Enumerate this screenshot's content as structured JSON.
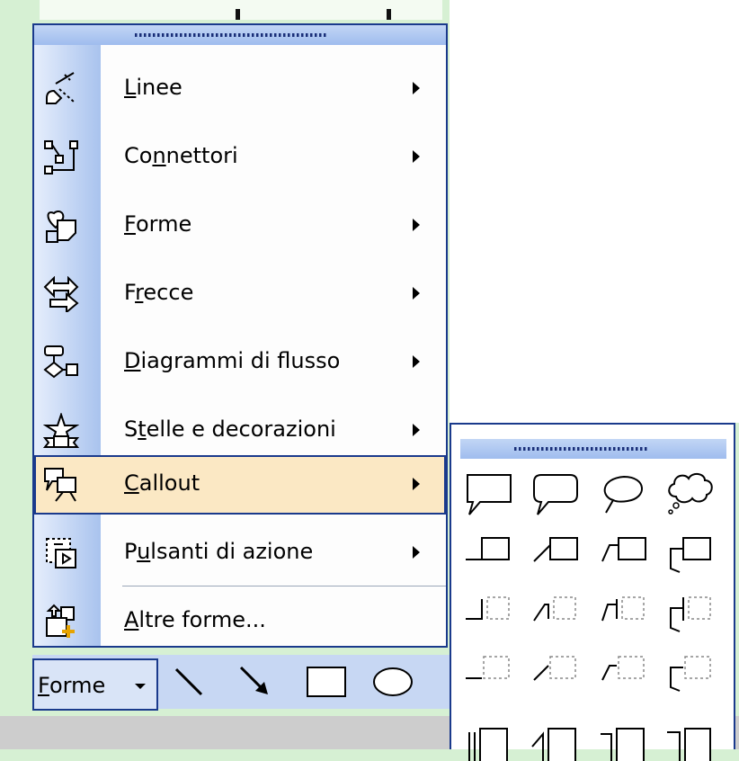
{
  "menu": {
    "items": [
      {
        "label_pre": "",
        "label_key": "L",
        "label_post": "inee",
        "icon": "lines-icon"
      },
      {
        "label_pre": "Co",
        "label_key": "n",
        "label_post": "nettori",
        "icon": "connectors-icon"
      },
      {
        "label_pre": "",
        "label_key": "F",
        "label_post": "orme",
        "icon": "basic-shapes-icon"
      },
      {
        "label_pre": "F",
        "label_key": "r",
        "label_post": "ecce",
        "icon": "block-arrows-icon"
      },
      {
        "label_pre": "",
        "label_key": "D",
        "label_post": "iagrammi di flusso",
        "icon": "flowchart-icon"
      },
      {
        "label_pre": "S",
        "label_key": "t",
        "label_post": "elle e decorazioni",
        "icon": "stars-banners-icon"
      },
      {
        "label_pre": "",
        "label_key": "C",
        "label_post": "allout",
        "icon": "callouts-icon"
      },
      {
        "label_pre": "P",
        "label_key": "u",
        "label_post": "lsanti di azione",
        "icon": "action-buttons-icon"
      },
      {
        "label_pre": "",
        "label_key": "A",
        "label_post": "ltre forme...",
        "icon": "more-autoshapes-icon"
      }
    ],
    "active_item": "Callout"
  },
  "toolbar": {
    "forme_key": "F",
    "forme_rest": "orme",
    "tools": [
      "line-icon",
      "arrow-icon",
      "rectangle-icon",
      "oval-icon"
    ]
  },
  "palette": {
    "title_icon": "grip-icon"
  },
  "colors": {
    "border": "#1a3a8c",
    "highlight": "#fbe8c4",
    "background": "#d6f0d3"
  }
}
